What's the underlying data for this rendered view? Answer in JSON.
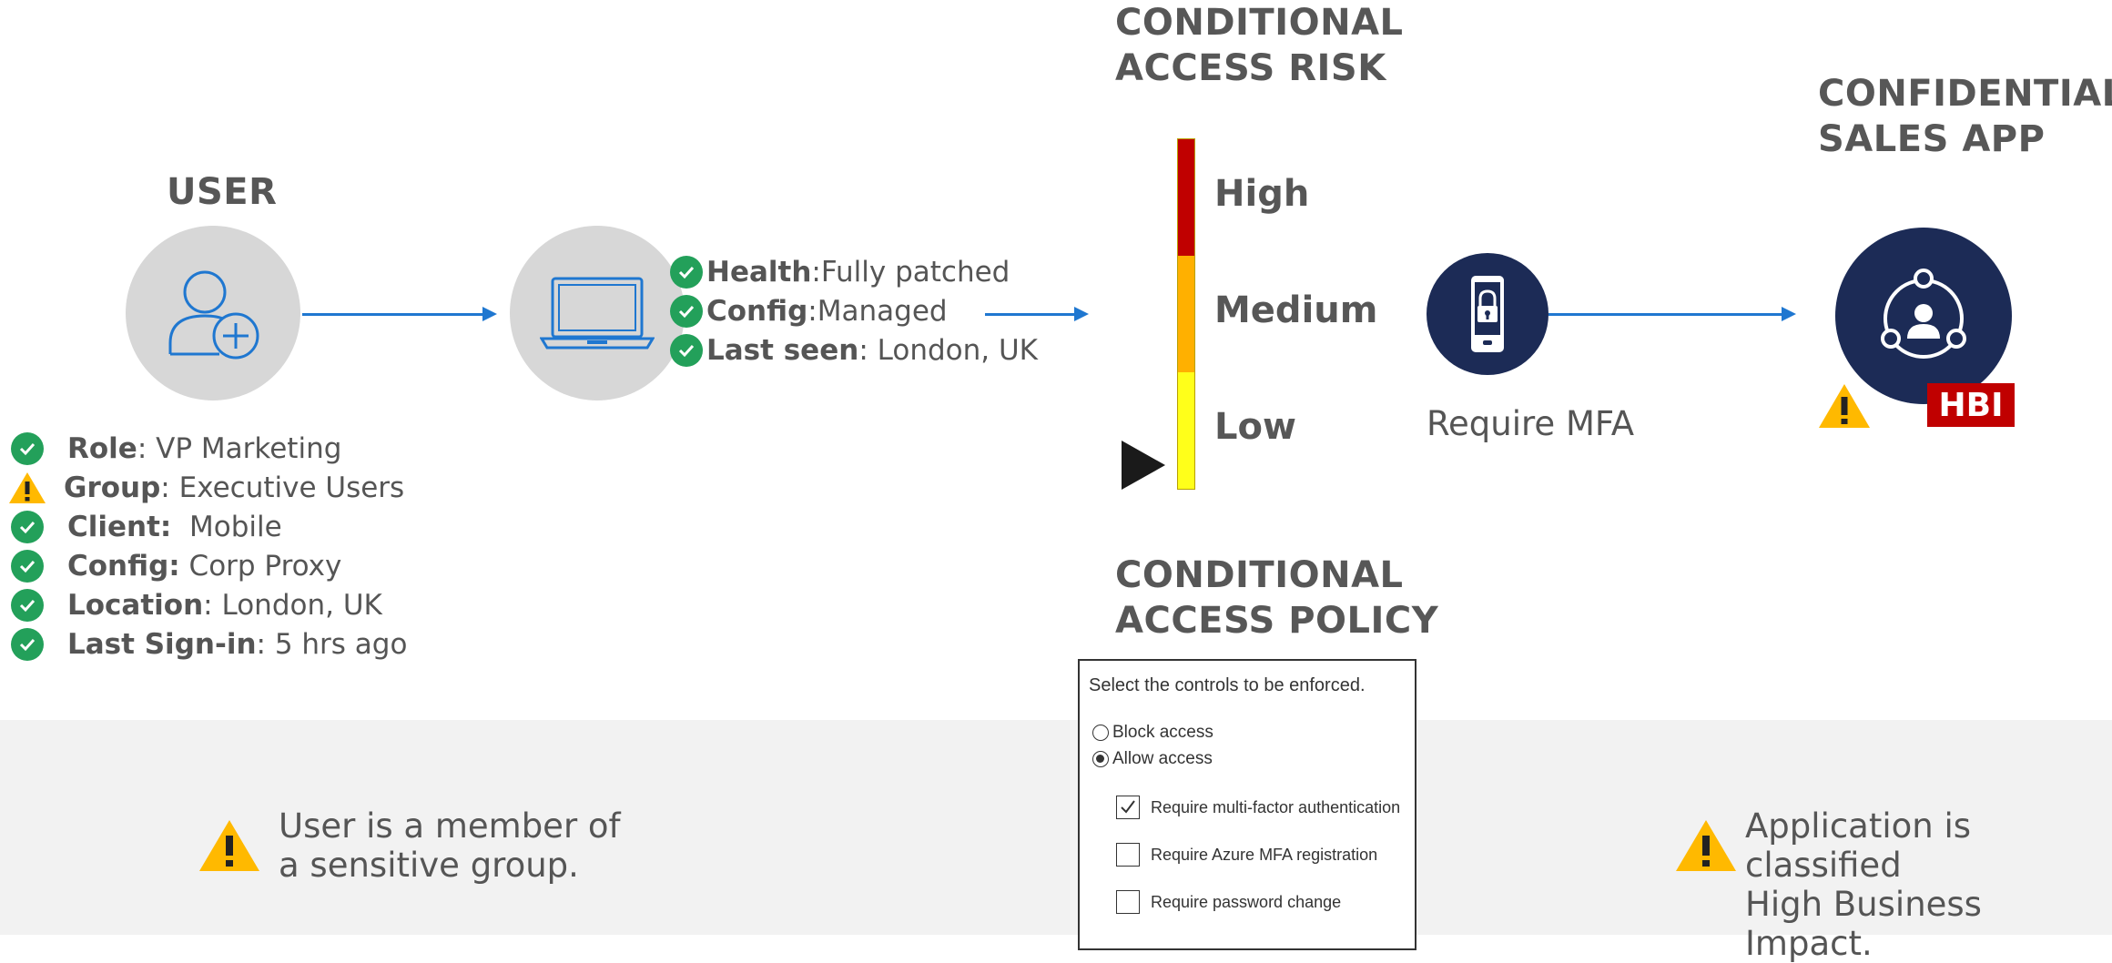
{
  "user": {
    "heading": "USER",
    "attributes": [
      {
        "key": "Role",
        "sep": ": ",
        "value": "VP Marketing",
        "status": "ok"
      },
      {
        "key": "Group",
        "sep": ": ",
        "value": "Executive Users",
        "status": "warning"
      },
      {
        "key": "Client:",
        "sep": "  ",
        "value": "Mobile",
        "status": "ok"
      },
      {
        "key": "Config:",
        "sep": " ",
        "value": "Corp Proxy",
        "status": "ok"
      },
      {
        "key": "Location",
        "sep": ": ",
        "value": "London, UK",
        "status": "ok"
      },
      {
        "key": "Last Sign-in",
        "sep": ": ",
        "value": "5 hrs ago",
        "status": "ok"
      }
    ]
  },
  "device": {
    "attributes": [
      {
        "key": "Health",
        "sep": ":",
        "value": "Fully patched"
      },
      {
        "key": "Config",
        "sep": ":",
        "value": "Managed"
      },
      {
        "key": "Last seen",
        "sep": ": ",
        "value": "London, UK"
      }
    ]
  },
  "risk": {
    "heading_line1": "CONDITIONAL",
    "heading_line2": "ACCESS RISK",
    "levels": [
      {
        "label": "High",
        "color": "#c00000"
      },
      {
        "label": "Medium",
        "color": "#ffb000"
      },
      {
        "label": "Low",
        "color": "#ffff1a"
      }
    ],
    "current_level": "Low"
  },
  "mfa": {
    "label": "Require MFA"
  },
  "app": {
    "heading_line1": "CONFIDENTIAL",
    "heading_line2": "SALES APP",
    "badge": "HBI",
    "badge_color": "#c00000"
  },
  "policy": {
    "heading_line1": "CONDITIONAL",
    "heading_line2": "ACCESS POLICY",
    "intro": "Select the controls to be enforced.",
    "radios": [
      {
        "label": "Block access",
        "selected": false
      },
      {
        "label": "Allow access",
        "selected": true
      }
    ],
    "checkboxes": [
      {
        "label": "Require multi-factor authentication",
        "checked": true
      },
      {
        "label": "Require Azure MFA registration",
        "checked": false
      },
      {
        "label": "Require password change",
        "checked": false
      }
    ]
  },
  "notes": {
    "user_line1": "User is a member of",
    "user_line2": "a sensitive group.",
    "app_line1": "Application is classified",
    "app_line2": "High Business Impact."
  },
  "colors": {
    "ok": "#23a05a",
    "warning": "#ffb900",
    "arrow": "#1f77d0",
    "navy": "#1c2b56"
  }
}
